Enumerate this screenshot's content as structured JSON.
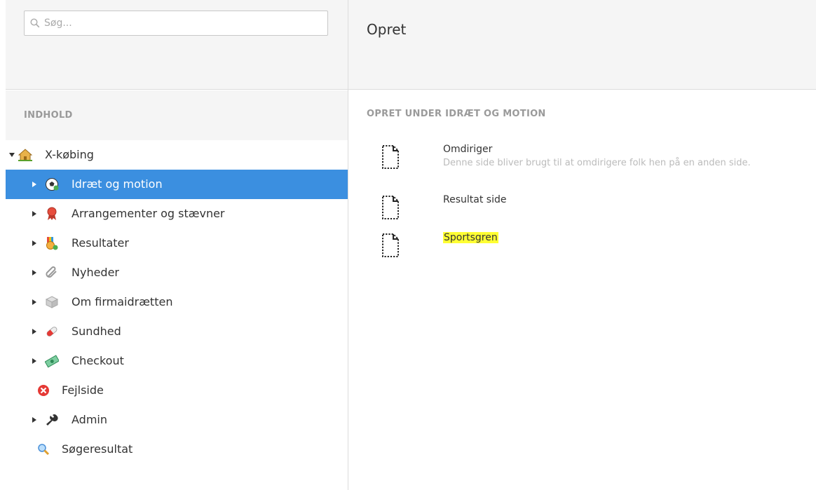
{
  "search": {
    "placeholder": "Søg..."
  },
  "tree": {
    "header": "INDHOLD",
    "root": {
      "label": "X-købing",
      "icon": "house-icon"
    },
    "items": [
      {
        "label": "Idræt og motion",
        "icon": "soccer-ball-icon",
        "selected": true,
        "expandable": true
      },
      {
        "label": "Arrangementer og stævner",
        "icon": "ribbon-award-icon",
        "selected": false,
        "expandable": true
      },
      {
        "label": "Resultater",
        "icon": "medal-icon",
        "selected": false,
        "expandable": true
      },
      {
        "label": "Nyheder",
        "icon": "paperclip-icon",
        "selected": false,
        "expandable": true
      },
      {
        "label": "Om firmaidrætten",
        "icon": "box-icon",
        "selected": false,
        "expandable": true
      },
      {
        "label": "Sundhed",
        "icon": "pill-icon",
        "selected": false,
        "expandable": true
      },
      {
        "label": "Checkout",
        "icon": "money-icon",
        "selected": false,
        "expandable": true
      },
      {
        "label": "Fejlside",
        "icon": "error-icon",
        "selected": false,
        "expandable": false
      },
      {
        "label": "Admin",
        "icon": "wrench-icon",
        "selected": false,
        "expandable": true
      },
      {
        "label": "Søgeresultat",
        "icon": "magnifier-icon",
        "selected": false,
        "expandable": false
      }
    ]
  },
  "main": {
    "title": "Opret",
    "section_title": "OPRET UNDER IDRÆT OG MOTION",
    "doc_types": [
      {
        "name": "Omdiriger",
        "description": "Denne side bliver brugt til at omdirigere folk hen på en anden side.",
        "highlighted": false
      },
      {
        "name": "Resultat side",
        "description": "",
        "highlighted": false
      },
      {
        "name": "Sportsgren",
        "description": "",
        "highlighted": true
      }
    ]
  },
  "colors": {
    "selected_bg": "#3b8fe0",
    "highlight": "#ffff33",
    "header_bg": "#f5f5f5"
  }
}
